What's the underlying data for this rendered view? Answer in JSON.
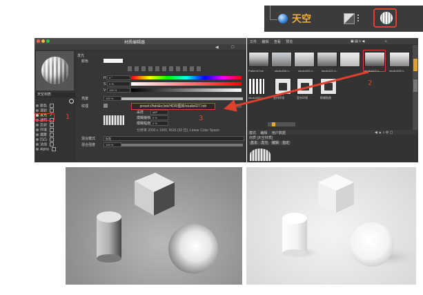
{
  "top_snippet": {
    "object_label": "天空",
    "icons": [
      "sky-globe-icon",
      "material-tag-icon",
      "material-ball-icon"
    ]
  },
  "material_editor": {
    "title": "材质编辑器",
    "material_name": "天空材质",
    "channels": [
      {
        "label": "颜色",
        "checked": false
      },
      {
        "label": "漫射",
        "checked": false
      },
      {
        "label": "发光",
        "checked": true
      },
      {
        "label": "透明",
        "checked": false
      },
      {
        "label": "反射",
        "checked": false
      },
      {
        "label": "环境",
        "checked": false
      },
      {
        "label": "烟雾",
        "checked": false
      },
      {
        "label": "凹凸",
        "checked": false
      },
      {
        "label": "法线",
        "checked": false
      },
      {
        "label": "Alpha",
        "checked": false
      }
    ],
    "section_title": "发光",
    "color_label": "颜色",
    "h_label": "H",
    "h_value": "0 °",
    "s_label": "S",
    "s_value": "0 %",
    "v_label": "V",
    "v_value": "100 %",
    "brightness_label": "亮度",
    "brightness_value": "100 %",
    "texture_label": "纹理",
    "texture_path": "preset://hdri&o;link/HDRI图库/studio027.hdr",
    "sampling_label": "采样",
    "sampling_value": "MIP",
    "blur_offset_label": "模糊偏移",
    "blur_offset_value": "0 %",
    "blur_scale_label": "模糊程度",
    "blur_scale_value": "0 %",
    "resolution_info": "分辨率 2000 x 1000, RGB (32 位), Linear Color Space",
    "mix_mode_label": "混合模式",
    "mix_mode_value": "标准",
    "mix_strength_label": "混合强度",
    "mix_strength_value": "100 %",
    "annotation_1": "1",
    "annotation_3": "3"
  },
  "browser": {
    "menu": [
      "文件",
      "编辑",
      "查看",
      "预览"
    ],
    "row1": [
      {
        "name": "Pattern2.hdr"
      },
      {
        "name": "studio008.h.."
      },
      {
        "name": "studio020.h.."
      },
      {
        "name": "studio021.h.."
      },
      {
        "name": "studio027.h.."
      },
      {
        "name": "studio028.h.."
      }
    ],
    "row2": [
      {
        "name": "studio032.h.."
      },
      {
        "name": "室内环境"
      },
      {
        "name": "室外环境"
      },
      {
        "name": "影棚贴图"
      }
    ],
    "annotation_2": "2",
    "attr_menu": [
      "模式",
      "编辑",
      "用户数据"
    ],
    "attr_title": "材质 [天空材质]",
    "attr_tabs": [
      "基本",
      "发光",
      "编辑",
      "指定"
    ]
  },
  "colors": {
    "annotation_red": "#e0402e",
    "sky_label_orange": "#f0b02a"
  }
}
